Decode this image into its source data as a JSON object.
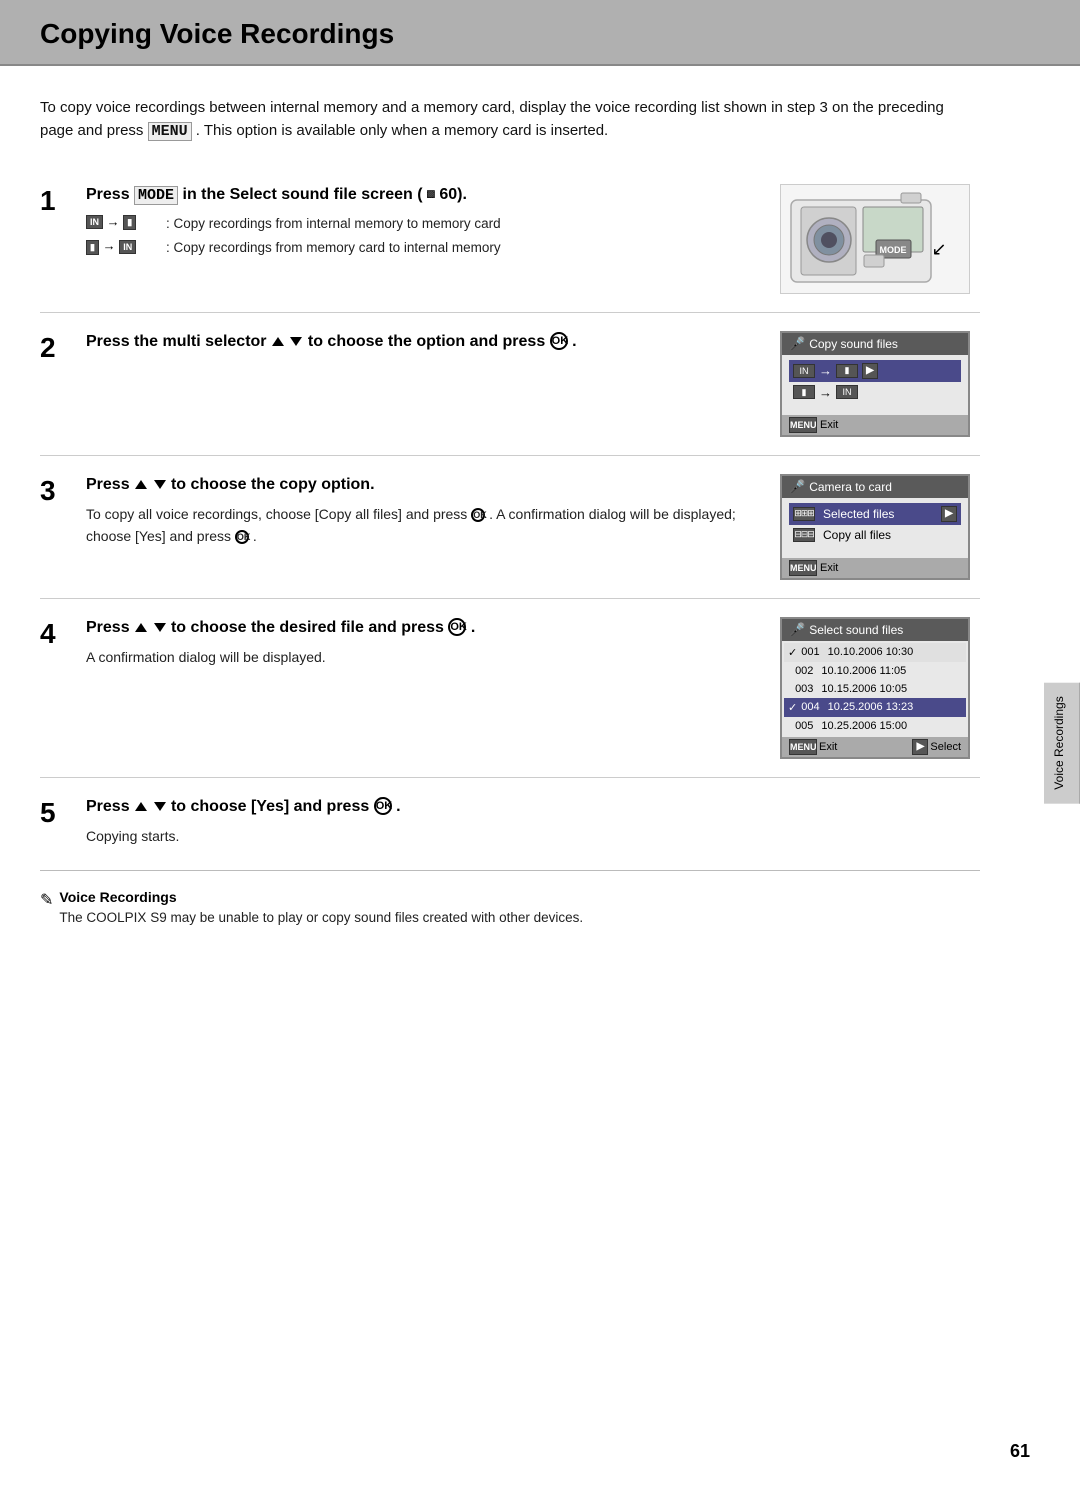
{
  "header": {
    "title": "Copying Voice Recordings"
  },
  "intro": {
    "text": "To copy voice recordings between internal memory and a memory card, display the voice recording list shown in step 3 on the preceding page and press",
    "menu_code": "MENU",
    "text2": ". This option is available only when a memory card is inserted."
  },
  "steps": [
    {
      "number": "1",
      "title_pre": "Press",
      "mode_code": "MODE",
      "title_post": "in the Select sound file screen (",
      "page_ref": "60).",
      "sub1_label": "→",
      "sub1_text": ": Copy recordings from internal memory to memory card",
      "sub2_label": "→",
      "sub2_text": ": Copy recordings from memory card to internal memory"
    },
    {
      "number": "2",
      "title": "Press the multi selector",
      "title2": "to choose the option and press",
      "lcd_title": "Copy sound files",
      "lcd_footer": "Exit"
    },
    {
      "number": "3",
      "title": "Press",
      "title2": "to choose the copy option.",
      "desc": "To copy all voice recordings, choose [Copy all files] and press",
      "desc2": ". A confirmation dialog will be displayed; choose [Yes] and press",
      "desc3": ".",
      "lcd_title": "Camera to card",
      "lcd_row1": "Selected files",
      "lcd_row2": "Copy all files",
      "lcd_footer": "Exit"
    },
    {
      "number": "4",
      "title": "Press",
      "title2": "to choose the desired file and press",
      "title3": ".",
      "desc": "A confirmation dialog will be displayed.",
      "lcd_title": "Select sound files",
      "lcd_rows": [
        {
          "num": "001",
          "date": "10.10.2006 10:30",
          "checked": true
        },
        {
          "num": "002",
          "date": "10.10.2006 11:05",
          "checked": false
        },
        {
          "num": "003",
          "date": "10.15.2006 10:05",
          "checked": false
        },
        {
          "num": "004",
          "date": "10.25.2006 13:23",
          "checked": true,
          "selected": true
        },
        {
          "num": "005",
          "date": "10.25.2006 15:00",
          "checked": false
        }
      ],
      "lcd_footer_left": "Exit",
      "lcd_footer_right": "Select"
    },
    {
      "number": "5",
      "title": "Press",
      "title2": "to choose [Yes] and press",
      "title3": ".",
      "desc": "Copying starts."
    }
  ],
  "note": {
    "icon": "✎",
    "title": "Voice Recordings",
    "text": "The COOLPIX S9 may be unable to play or copy sound files created with other devices."
  },
  "page_number": "61",
  "side_tab": "Voice Recordings"
}
